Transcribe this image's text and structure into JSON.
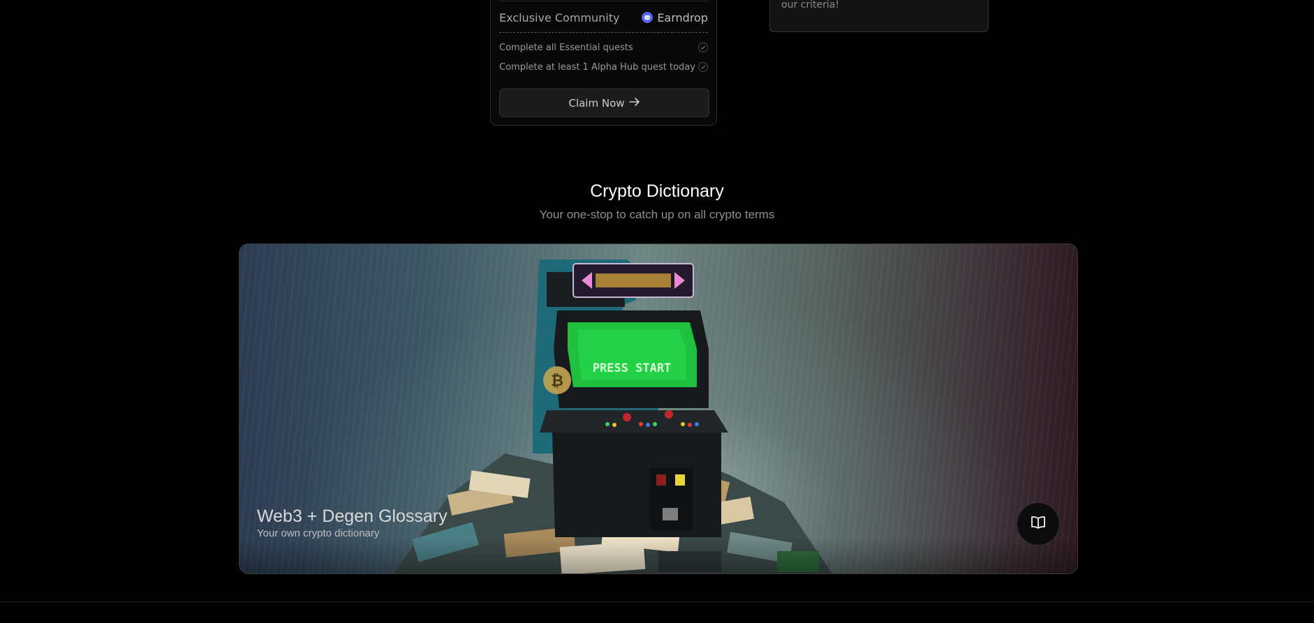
{
  "quest_card": {
    "community_label": "Exclusive Community",
    "badge_label": "Earndrop",
    "badge_icon": "discord-icon",
    "requirements": [
      {
        "label": "Complete all Essential quests",
        "icon": "check-circle-icon"
      },
      {
        "label": "Complete at least 1 Alpha Hub quest today",
        "icon": "check-circle-icon"
      }
    ],
    "claim_label": "Claim Now",
    "claim_icon": "arrow-right-icon"
  },
  "side_card": {
    "text": "our criteria!"
  },
  "dictionary": {
    "title": "Crypto Dictionary",
    "subtitle": "Your one-stop to catch up on all crypto terms",
    "card": {
      "title": "Web3 + Degen Glossary",
      "subtitle": "Your own crypto dictionary",
      "screen_text": "PRESS START",
      "button_icon": "book-icon"
    }
  }
}
